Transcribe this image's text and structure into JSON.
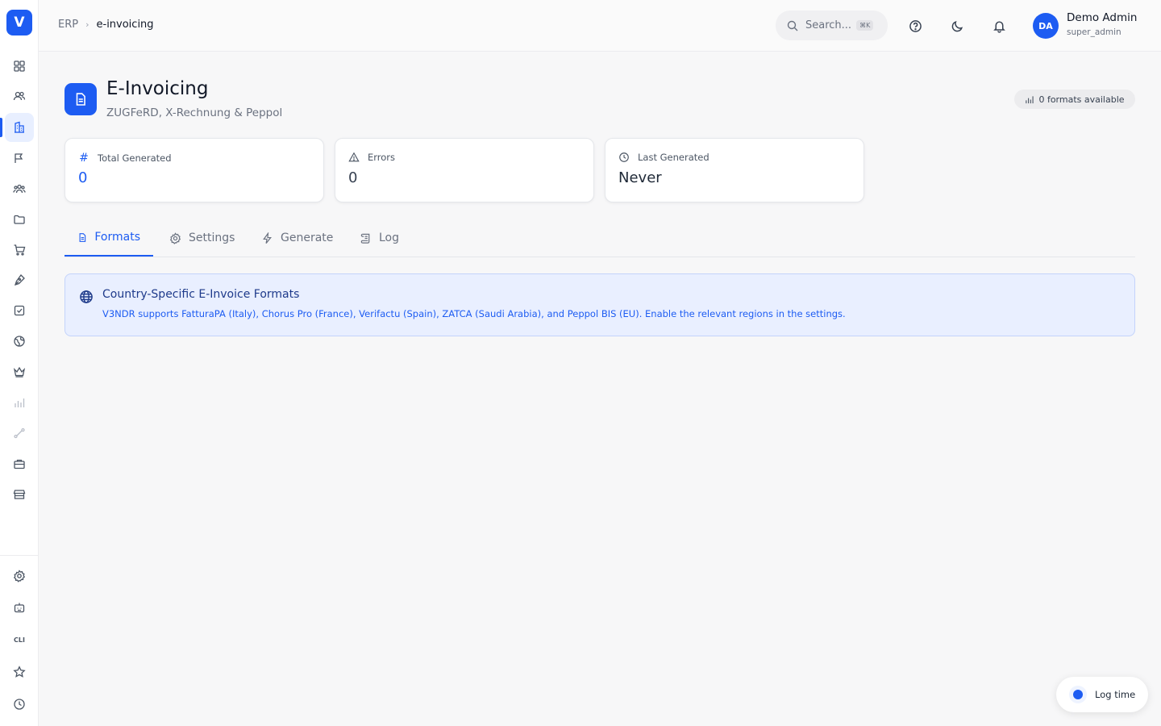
{
  "app": {
    "logo_letter": "V"
  },
  "breadcrumb": {
    "root": "ERP",
    "separator": "›",
    "current": "e-invoicing"
  },
  "search": {
    "placeholder": "Search...",
    "shortcut": "⌘K"
  },
  "user": {
    "initials": "DA",
    "name": "Demo Admin",
    "role": "super_admin"
  },
  "page": {
    "title": "E-Invoicing",
    "subtitle": "ZUGFeRD, X-Rechnung & Peppol",
    "formats_badge": "0 formats available"
  },
  "stats": [
    {
      "label": "Total Generated",
      "value": "0",
      "icon": "hash-icon"
    },
    {
      "label": "Errors",
      "value": "0",
      "icon": "warning-icon"
    },
    {
      "label": "Last Generated",
      "value": "Never",
      "icon": "clock-icon"
    }
  ],
  "tabs": [
    {
      "label": "Formats",
      "icon": "document-icon",
      "active": true
    },
    {
      "label": "Settings",
      "icon": "gear-icon",
      "active": false
    },
    {
      "label": "Generate",
      "icon": "lightning-icon",
      "active": false
    },
    {
      "label": "Log",
      "icon": "scroll-icon",
      "active": false
    }
  ],
  "info": {
    "title": "Country-Specific E-Invoice Formats",
    "text": "V3NDR supports FatturaPA (Italy), Chorus Pro (France), Verifactu (Spain), ZATCA (Saudi Arabia), and Peppol BIS (EU). Enable the relevant regions in the settings."
  },
  "sidebar": {
    "items": [
      "grid-icon",
      "users-icon",
      "building-icon",
      "flag-icon",
      "team-icon",
      "folder-icon",
      "cart-icon",
      "pen-icon",
      "checkbox-icon",
      "globe-icon",
      "crown-icon",
      "chart-icon",
      "route-icon",
      "briefcase-icon",
      "store-icon"
    ],
    "bottom_items": [
      "gear-icon",
      "robot-icon",
      "cli-icon",
      "star-icon",
      "clock-icon"
    ],
    "cli_label": "CLI"
  },
  "floating": {
    "log_time_label": "Log time"
  },
  "colors": {
    "accent": "#1d5cf2",
    "info_bg": "#e9efff",
    "info_border": "#c3d3fb"
  }
}
